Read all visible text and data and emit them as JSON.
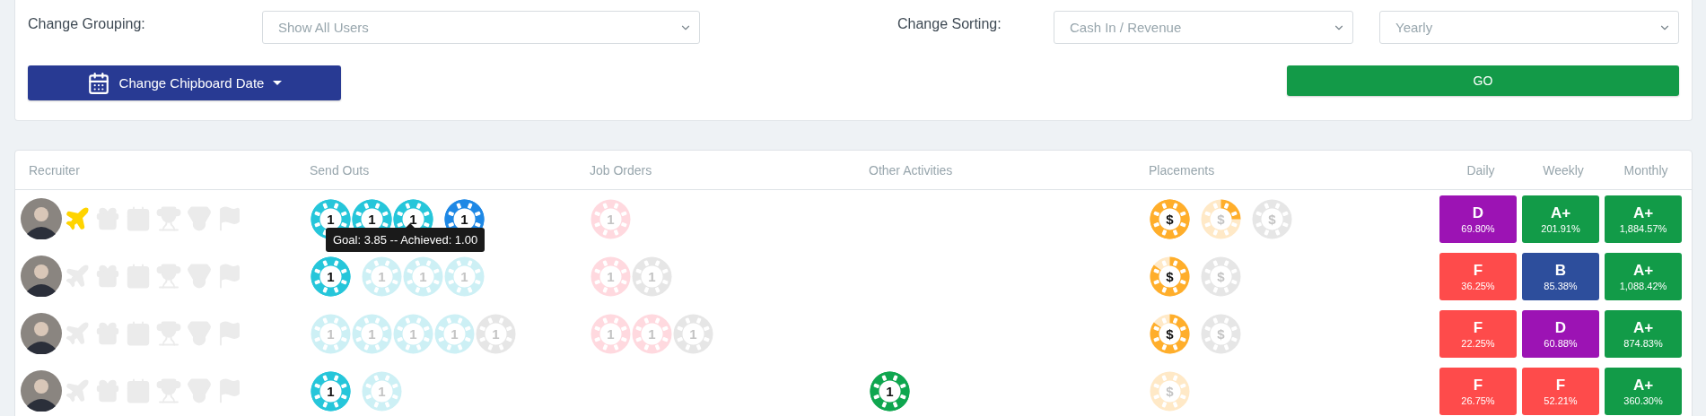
{
  "filters": {
    "grouping_label": "Change Grouping:",
    "grouping": "Show All Users",
    "sorting_label": "Change Sorting:",
    "sorting": "Cash In / Revenue",
    "period": "Yearly"
  },
  "date_button": "Change Chipboard Date",
  "go_button": "GO",
  "table": {
    "columns": [
      "Recruiter",
      "Send Outs",
      "Job Orders",
      "Other Activities",
      "Placements",
      "Daily",
      "Weekly",
      "Monthly"
    ],
    "rows": [
      {
        "badges": [
          {
            "kind": "plane",
            "on": true
          },
          {
            "kind": "gift",
            "on": false
          },
          {
            "kind": "calendar",
            "on": false
          },
          {
            "kind": "trophy",
            "on": false
          },
          {
            "kind": "medal",
            "on": false
          },
          {
            "kind": "flag",
            "on": false
          }
        ],
        "send_outs": [
          {
            "label": "1",
            "kind": "full"
          },
          {
            "label": "1",
            "kind": "full"
          },
          {
            "label": "1",
            "kind": "full"
          },
          {
            "label": "1",
            "kind": "extra"
          }
        ],
        "tooltip": "Goal: 3.85 -- Achieved: 1.00",
        "job_orders": [
          {
            "label": "1",
            "kind": "empty",
            "tinted": true
          }
        ],
        "placements": [
          {
            "label": "$",
            "kind": "full"
          },
          {
            "label": "$",
            "kind": "quarter",
            "tinted": true
          },
          {
            "label": "$",
            "kind": "empty",
            "tinted": false
          }
        ],
        "grades": [
          {
            "grade": "D",
            "percent": "69.80%",
            "color": "#9c13b4"
          },
          {
            "grade": "A+",
            "percent": "201.91%",
            "color": "#129b48"
          },
          {
            "grade": "A+",
            "percent": "1,884.57%",
            "color": "#129b48"
          }
        ]
      },
      {
        "badges": [
          {
            "kind": "plane",
            "on": false
          },
          {
            "kind": "gift",
            "on": false
          },
          {
            "kind": "calendar",
            "on": false
          },
          {
            "kind": "trophy",
            "on": false
          },
          {
            "kind": "medal",
            "on": false
          },
          {
            "kind": "flag",
            "on": false
          }
        ],
        "send_outs": [
          {
            "label": "1",
            "kind": "full"
          },
          {
            "label": "1",
            "kind": "empty",
            "tinted": true
          },
          {
            "label": "1",
            "kind": "empty",
            "tinted": true
          },
          {
            "label": "1",
            "kind": "empty",
            "tinted": true
          }
        ],
        "job_orders": [
          {
            "label": "1",
            "kind": "empty",
            "tinted": true
          },
          {
            "label": "1",
            "kind": "empty",
            "tinted": false
          }
        ],
        "placements": [
          {
            "label": "$",
            "kind": "most",
            "tinted": true
          },
          {
            "label": "$",
            "kind": "empty",
            "tinted": false
          }
        ],
        "grades": [
          {
            "grade": "F",
            "percent": "36.25%",
            "color": "#fe4b4b"
          },
          {
            "grade": "B",
            "percent": "85.38%",
            "color": "#2d4e9c"
          },
          {
            "grade": "A+",
            "percent": "1,088.42%",
            "color": "#129b48"
          }
        ]
      },
      {
        "badges": [
          {
            "kind": "plane",
            "on": false
          },
          {
            "kind": "gift",
            "on": false
          },
          {
            "kind": "calendar",
            "on": false
          },
          {
            "kind": "trophy",
            "on": false
          },
          {
            "kind": "medal",
            "on": false
          },
          {
            "kind": "flag",
            "on": false
          }
        ],
        "send_outs": [
          {
            "label": "1",
            "kind": "empty",
            "tinted": true
          },
          {
            "label": "1",
            "kind": "empty",
            "tinted": true
          },
          {
            "label": "1",
            "kind": "empty",
            "tinted": true
          },
          {
            "label": "1",
            "kind": "empty",
            "tinted": true
          },
          {
            "label": "1",
            "kind": "empty",
            "tinted": false
          }
        ],
        "job_orders": [
          {
            "label": "1",
            "kind": "empty",
            "tinted": true
          },
          {
            "label": "1",
            "kind": "empty",
            "tinted": true
          },
          {
            "label": "1",
            "kind": "empty",
            "tinted": false
          }
        ],
        "placements": [
          {
            "label": "$",
            "kind": "most",
            "tinted": true
          },
          {
            "label": "$",
            "kind": "empty",
            "tinted": false
          }
        ],
        "grades": [
          {
            "grade": "F",
            "percent": "22.25%",
            "color": "#fe4b4b"
          },
          {
            "grade": "D",
            "percent": "60.88%",
            "color": "#9c13b4"
          },
          {
            "grade": "A+",
            "percent": "874.83%",
            "color": "#129b48"
          }
        ]
      },
      {
        "badges": [
          {
            "kind": "plane",
            "on": false
          },
          {
            "kind": "gift",
            "on": false
          },
          {
            "kind": "calendar",
            "on": false
          },
          {
            "kind": "trophy",
            "on": false
          },
          {
            "kind": "medal",
            "on": false
          },
          {
            "kind": "flag",
            "on": false
          }
        ],
        "send_outs": [
          {
            "label": "1",
            "kind": "full"
          },
          {
            "label": "1",
            "kind": "empty",
            "tinted": true
          }
        ],
        "other_activities": [
          {
            "label": "1",
            "kind": "full"
          }
        ],
        "placements": [
          {
            "label": "$",
            "kind": "empty",
            "tinted": true
          }
        ],
        "grades": [
          {
            "grade": "F",
            "percent": "26.75%",
            "color": "#fe4b4b"
          },
          {
            "grade": "F",
            "percent": "52.21%",
            "color": "#fe4b4b"
          },
          {
            "grade": "A+",
            "percent": "360.30%",
            "color": "#129b48"
          }
        ]
      }
    ]
  }
}
